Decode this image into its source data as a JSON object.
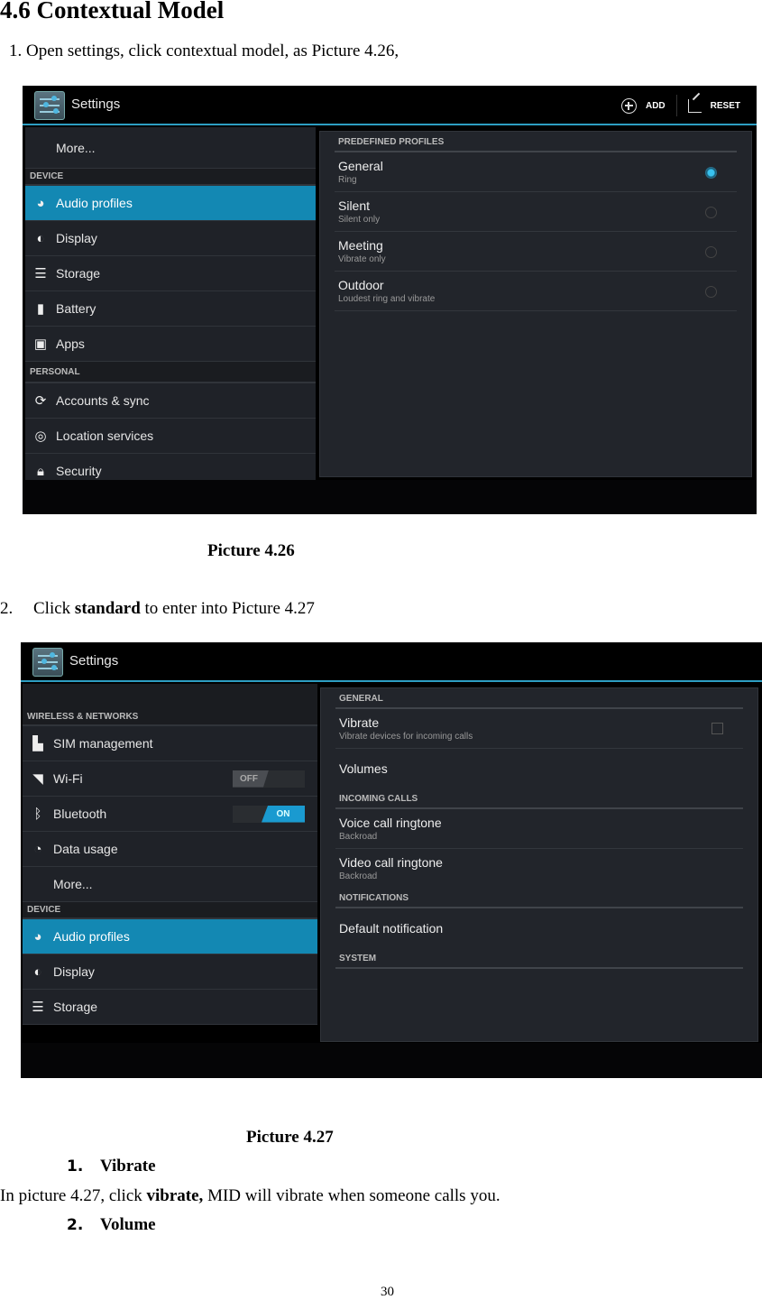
{
  "document": {
    "heading": "4.6 Contextual Model",
    "step1": "1. Open settings, click contextual model, as Picture 4.26,",
    "caption1": "Picture 4.26",
    "step2_num": "2.",
    "step2_pre": "Click ",
    "step2_bold": "standard",
    "step2_post": " to enter into Picture 4.27",
    "caption2": "Picture 4.27",
    "sub1_num": "1.",
    "sub1_label": "Vibrate",
    "para_pre": "In picture 4.27, click ",
    "para_bold": "vibrate,",
    "para_post": " MID will vibrate when someone calls you.",
    "sub2_num": "2.",
    "sub2_label": "Volume",
    "page_number": "30"
  },
  "screen1": {
    "app_title": "Settings",
    "actions": {
      "add": "ADD",
      "reset": "RESET"
    },
    "sidebar": {
      "more": "More...",
      "device_header": "DEVICE",
      "device_items": [
        {
          "label": "Audio profiles",
          "icon": "audio-profiles-icon",
          "selected": true
        },
        {
          "label": "Display",
          "icon": "display-icon"
        },
        {
          "label": "Storage",
          "icon": "storage-icon"
        },
        {
          "label": "Battery",
          "icon": "battery-icon"
        },
        {
          "label": "Apps",
          "icon": "apps-icon"
        }
      ],
      "personal_header": "PERSONAL",
      "personal_items": [
        {
          "label": "Accounts & sync",
          "icon": "sync-icon"
        },
        {
          "label": "Location services",
          "icon": "location-icon"
        },
        {
          "label": "Security",
          "icon": "lock-icon"
        }
      ]
    },
    "profiles": {
      "header": "PREDEFINED PROFILES",
      "items": [
        {
          "title": "General",
          "subtitle": "Ring",
          "checked": true
        },
        {
          "title": "Silent",
          "subtitle": "Silent only",
          "checked": false
        },
        {
          "title": "Meeting",
          "subtitle": "Vibrate only",
          "checked": false
        },
        {
          "title": "Outdoor",
          "subtitle": "Loudest ring and vibrate",
          "checked": false
        }
      ]
    },
    "accent_color": "#2d9ec2"
  },
  "screen2": {
    "app_title": "Settings",
    "sidebar": {
      "wireless_header": "WIRELESS & NETWORKS",
      "wireless_items": [
        {
          "label": "SIM management",
          "icon": "sim-icon"
        },
        {
          "label": "Wi-Fi",
          "icon": "wifi-icon",
          "toggle": "OFF"
        },
        {
          "label": "Bluetooth",
          "icon": "bluetooth-icon",
          "toggle": "ON"
        },
        {
          "label": "Data usage",
          "icon": "data-usage-icon"
        }
      ],
      "more": "More...",
      "device_header": "DEVICE",
      "device_items": [
        {
          "label": "Audio profiles",
          "icon": "audio-profiles-icon",
          "selected": true
        },
        {
          "label": "Display",
          "icon": "display-icon"
        },
        {
          "label": "Storage",
          "icon": "storage-icon"
        }
      ]
    },
    "detail": {
      "general_header": "GENERAL",
      "vibrate_title": "Vibrate",
      "vibrate_subtitle": "Vibrate devices for incoming calls",
      "vibrate_checked": false,
      "volumes": "Volumes",
      "incoming_header": "INCOMING CALLS",
      "voice_title": "Voice call ringtone",
      "voice_subtitle": "Backroad",
      "video_title": "Video call ringtone",
      "video_subtitle": "Backroad",
      "notifications_header": "NOTIFICATIONS",
      "default_notification": "Default notification",
      "system_header": "SYSTEM"
    }
  }
}
